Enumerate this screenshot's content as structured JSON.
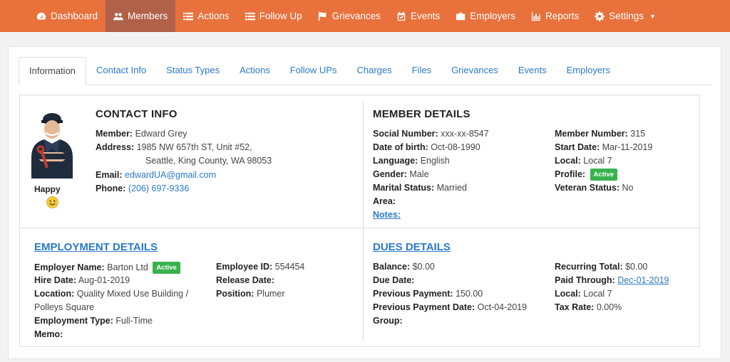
{
  "nav": [
    {
      "label": "Dashboard",
      "icon": "dashboard-icon",
      "active": false
    },
    {
      "label": "Members",
      "icon": "members-icon",
      "active": true
    },
    {
      "label": "Actions",
      "icon": "list-icon",
      "active": false
    },
    {
      "label": "Follow Up",
      "icon": "list-icon",
      "active": false
    },
    {
      "label": "Grievances",
      "icon": "flag-icon",
      "active": false
    },
    {
      "label": "Events",
      "icon": "calendar-check-icon",
      "active": false
    },
    {
      "label": "Employers",
      "icon": "briefcase-icon",
      "active": false
    },
    {
      "label": "Reports",
      "icon": "bar-chart-icon",
      "active": false
    },
    {
      "label": "Settings",
      "icon": "gear-icon",
      "active": false
    }
  ],
  "tabs": [
    "Information",
    "Contact Info",
    "Status Types",
    "Actions",
    "Follow UPs",
    "Charges",
    "Files",
    "Grievances",
    "Events",
    "Employers"
  ],
  "contact": {
    "title": "CONTACT INFO",
    "mood": "Happy",
    "member_label": "Member:",
    "member": "Edward Grey",
    "address_label": "Address:",
    "address1": "1985 NW 657th ST, Unit #52,",
    "address2": "Seattle, King County, WA 98053",
    "email_label": "Email:",
    "email": "edwardUA@gmail.com",
    "phone_label": "Phone:",
    "phone": "(206) 697-9336"
  },
  "member": {
    "title": "MEMBER DETAILS",
    "ssn_label": "Social Number:",
    "ssn": "xxx-xx-8547",
    "dob_label": "Date of birth:",
    "dob": "Oct-08-1990",
    "language_label": "Language:",
    "language": "English",
    "gender_label": "Gender:",
    "gender": "Male",
    "marital_label": "Marital Status:",
    "marital": "Married",
    "area_label": "Area:",
    "notes_label": "Notes:",
    "number_label": "Member Number:",
    "number": "315",
    "start_label": "Start Date:",
    "start": "Mar-11-2019",
    "local_label": "Local:",
    "local": "Local 7",
    "profile_label": "Profile:",
    "profile": "Active",
    "veteran_label": "Veteran Status:",
    "veteran": "No"
  },
  "employment": {
    "title": "EMPLOYMENT DETAILS",
    "employer_label": "Employer Name:",
    "employer": "Barton Ltd",
    "employer_status": "Active",
    "hire_label": "Hire Date:",
    "hire": "Aug-01-2019",
    "location_label": "Location:",
    "location1": "Quality Mixed Use Building /",
    "location2": "Polleys Square",
    "type_label": "Employment Type:",
    "type": "Full-Time",
    "memo_label": "Memo:",
    "empid_label": "Employee ID:",
    "empid": "554454",
    "release_label": "Release Date:",
    "position_label": "Position:",
    "position": "Plumer"
  },
  "dues": {
    "title": "DUES DETAILS",
    "balance_label": "Balance:",
    "balance": "$0.00",
    "due_label": "Due Date:",
    "prev_label": "Previous Payment:",
    "prev": "150.00",
    "prevdate_label": "Previous Payment Date:",
    "prevdate": "Oct-04-2019",
    "group_label": "Group:",
    "recurring_label": "Recurring Total:",
    "recurring": "$0.00",
    "paid_label": "Paid Through:",
    "paid": "Dec-01-2019",
    "local_label": "Local:",
    "local": "Local 7",
    "tax_label": "Tax Rate:",
    "tax": "0.00%"
  },
  "colors": {
    "nav": "#e8713c",
    "nav_active": "#b0614a",
    "link": "#2a7ac9",
    "badge": "#37b24d"
  }
}
